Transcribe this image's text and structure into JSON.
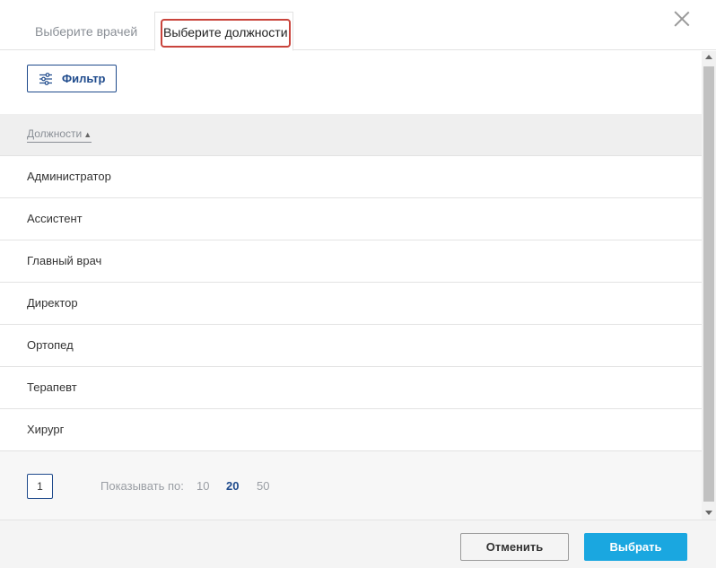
{
  "tabs": [
    {
      "label": "Выберите врачей",
      "active": false
    },
    {
      "label": "Выберите должности",
      "active": true
    }
  ],
  "filter": {
    "label": "Фильтр",
    "icon": "sliders-icon"
  },
  "table": {
    "column_header": "Должности",
    "sort_indicator": "▲",
    "rows": [
      "Администратор",
      "Ассистент",
      "Главный врач",
      "Директор",
      "Ортопед",
      "Терапевт",
      "Хирург"
    ]
  },
  "pagination": {
    "current_page": "1",
    "show_label": "Показывать по:",
    "page_sizes": [
      "10",
      "20",
      "50"
    ],
    "active_page_size": "20"
  },
  "footer": {
    "cancel_label": "Отменить",
    "select_label": "Выбрать"
  },
  "colors": {
    "accent": "#1e4a8c",
    "primary_button": "#1aa7e0",
    "highlight_border": "#c9443c"
  }
}
